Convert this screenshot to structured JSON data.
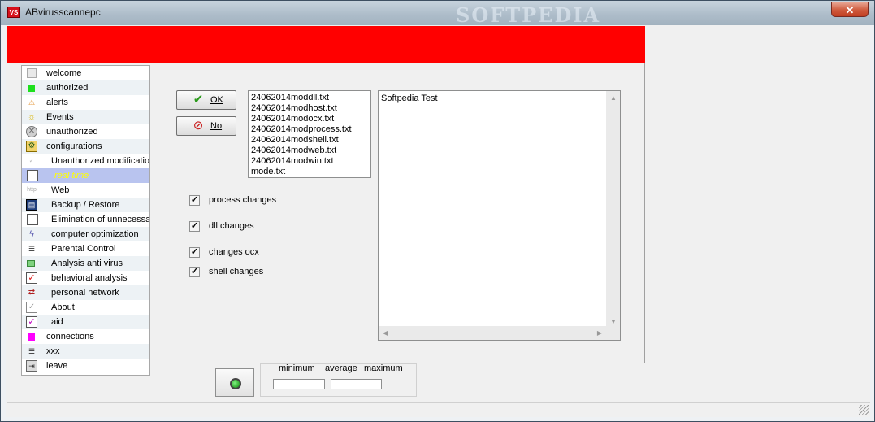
{
  "window": {
    "title": "ABvirusscannepc",
    "app_icon_text": "VS",
    "watermark": "SOFTPEDIA",
    "close_symbol": "✕"
  },
  "sidebar": {
    "items": [
      {
        "label": "welcome",
        "icon": "document-icon"
      },
      {
        "label": "authorized",
        "icon": "green-square-icon"
      },
      {
        "label": "alerts",
        "icon": "alert-icon"
      },
      {
        "label": "Events",
        "icon": "lightbulb-icon"
      },
      {
        "label": "unauthorized",
        "icon": "cross-circle-icon"
      },
      {
        "label": "configurations",
        "icon": "config-folder-icon"
      },
      {
        "label": "Unauthorized modifications",
        "icon": "check-small-icon"
      },
      {
        "label": "real time",
        "icon": "clock-icon",
        "selected": true
      },
      {
        "label": "Web",
        "icon": "web-icon"
      },
      {
        "label": "Backup / Restore",
        "icon": "floppy-icon"
      },
      {
        "label": "Elimination of unnecessary files",
        "icon": "trash-icon"
      },
      {
        "label": "computer optimization",
        "icon": "lightning-icon"
      },
      {
        "label": "Parental Control",
        "icon": "list-icon"
      },
      {
        "label": "Analysis anti virus",
        "icon": "green-box-icon"
      },
      {
        "label": "behavioral analysis",
        "icon": "red-check-icon"
      },
      {
        "label": "personal network",
        "icon": "network-icon"
      },
      {
        "label": "About",
        "icon": "check-outline-icon"
      },
      {
        "label": "aid",
        "icon": "magenta-check-icon"
      },
      {
        "label": "connections",
        "icon": "magenta-square-icon"
      },
      {
        "label": "xxx",
        "icon": "list-icon"
      },
      {
        "label": "leave",
        "icon": "exit-icon"
      }
    ]
  },
  "buttons": {
    "ok_label": "OK",
    "no_label": "No"
  },
  "file_list": {
    "items": [
      "24062014moddll.txt",
      "24062014modhost.txt",
      "24062014modocx.txt",
      "24062014modprocess.txt",
      "24062014modshell.txt",
      "24062014modweb.txt",
      "24062014modwin.txt",
      "mode.txt"
    ]
  },
  "checkboxes": [
    {
      "label": "process changes",
      "checked": true
    },
    {
      "label": "dll changes",
      "checked": true
    },
    {
      "label": "changes ocx",
      "checked": true
    },
    {
      "label": "shell changes",
      "checked": true
    }
  ],
  "text_area": {
    "value": "Softpedia Test"
  },
  "stats": {
    "minimum_label": "minimum",
    "average_label": "average",
    "maximum_label": "maximum",
    "minimum_value": "",
    "maximum_value": ""
  },
  "colors": {
    "banner": "#ff0000",
    "selected_row": "#b9c4ef",
    "selected_text": "#ffff00"
  }
}
